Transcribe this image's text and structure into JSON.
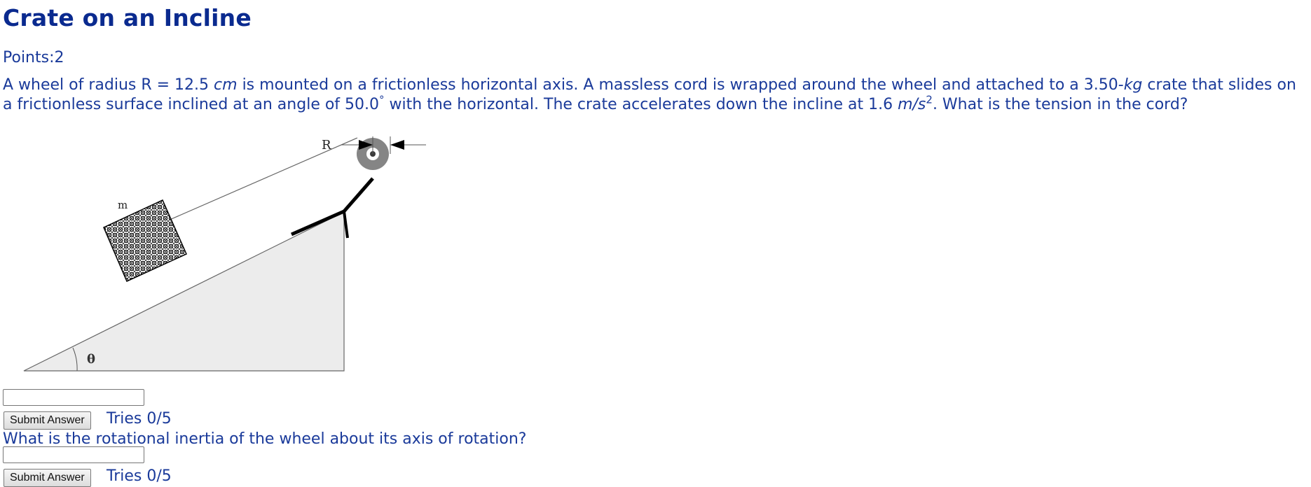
{
  "problem": {
    "title": "Crate on an Incline",
    "points_label": "Points:2",
    "text_parts": {
      "p1": "A wheel of radius R = 12.5 ",
      "unit_cm": "cm",
      "p2": " is mounted on a frictionless horizontal axis. A massless cord is wrapped around the wheel and attached to a 3.50-",
      "unit_kg": "kg",
      "p3": " crate that slides on a frictionless surface inclined at an angle of 50.0",
      "degree": "°",
      "p4": " with the horizontal. The crate accelerates down the incline at 1.6 ",
      "unit_ms": "m/s",
      "sup2": "2",
      "p5": ". What is the tension in the cord?"
    }
  },
  "figure": {
    "label_R": "R",
    "label_m": "m",
    "label_theta": "θ"
  },
  "part1": {
    "input_value": "",
    "submit_label": "Submit Answer",
    "tries_label": "Tries 0/5"
  },
  "part2": {
    "question": "What is the rotational inertia of the wheel about its axis of rotation?",
    "input_value": "",
    "submit_label": "Submit Answer",
    "tries_label": "Tries 0/5"
  }
}
